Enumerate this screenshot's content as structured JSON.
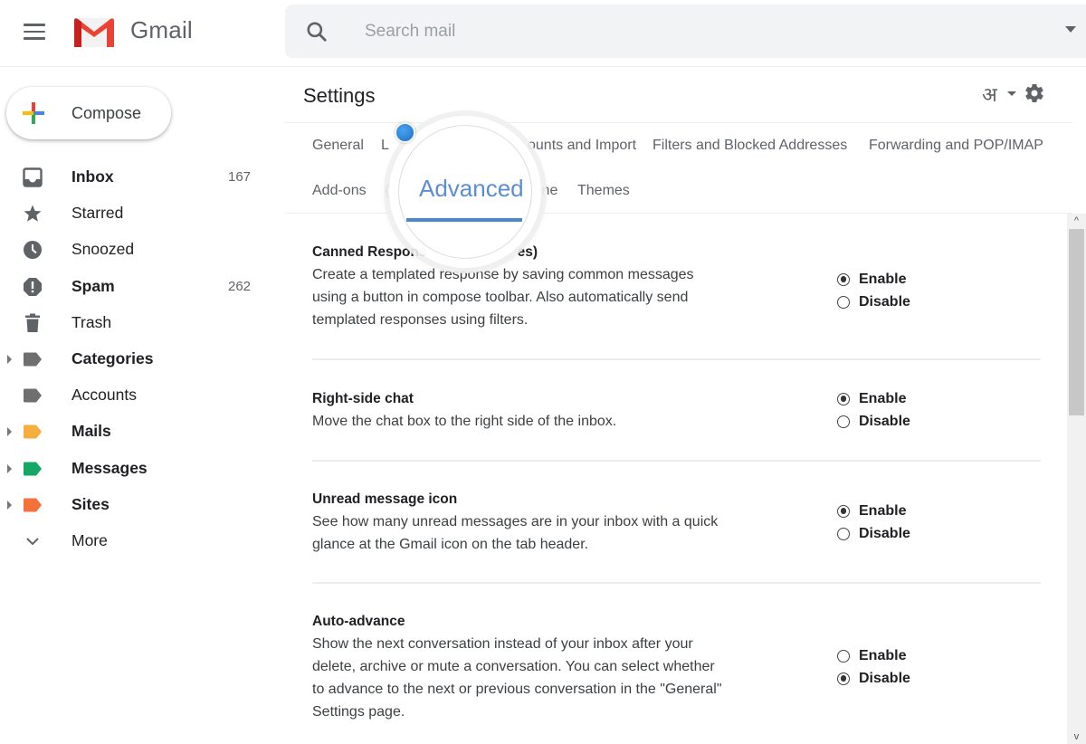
{
  "app": {
    "brand": "Gmail",
    "brand_color": "#EA4335"
  },
  "search": {
    "placeholder": "Search mail",
    "value": ""
  },
  "compose": {
    "label": "Compose"
  },
  "sidebar": {
    "items": [
      {
        "label": "Inbox",
        "count": "167",
        "bold": true,
        "icon": "inbox-icon"
      },
      {
        "label": "Starred",
        "count": "",
        "bold": false,
        "icon": "star-icon"
      },
      {
        "label": "Snoozed",
        "count": "",
        "bold": false,
        "icon": "clock-icon"
      },
      {
        "label": "Spam",
        "count": "262",
        "bold": true,
        "icon": "spam-icon"
      },
      {
        "label": "Trash",
        "count": "",
        "bold": false,
        "icon": "trash-icon"
      },
      {
        "label": "Categories",
        "count": "",
        "bold": true,
        "icon": "label-icon",
        "color": "#6f6f6f",
        "expandable": true
      },
      {
        "label": "Accounts",
        "count": "",
        "bold": false,
        "icon": "label-icon",
        "color": "#6f6f6f"
      },
      {
        "label": "Mails",
        "count": "",
        "bold": true,
        "icon": "label-icon",
        "color": "#F6AE3F",
        "expandable": true
      },
      {
        "label": "Messages",
        "count": "",
        "bold": true,
        "icon": "label-icon",
        "color": "#16A765",
        "expandable": true
      },
      {
        "label": "Sites",
        "count": "",
        "bold": true,
        "icon": "label-icon",
        "color": "#F4713A",
        "expandable": true
      },
      {
        "label": "More",
        "count": "",
        "bold": false,
        "icon": "chevron-down-icon"
      }
    ]
  },
  "settings": {
    "title": "Settings",
    "lang_glyph": "अ",
    "tabs_row1": [
      "General",
      "L",
      "ounts and Import",
      "Filters and Blocked Addresses",
      "Forwarding and POP/IMAP"
    ],
    "tabs_row2": [
      "Add-ons",
      "(",
      "ine",
      "Themes"
    ],
    "active_tab": "Advanced",
    "active_color": "#4A86D3",
    "sections": [
      {
        "name": "Canned Respons",
        "name_tail": "es)",
        "desc": "Create a templated response by saving common messages using a button in compose toolbar. Also automatically send templated responses using filters.",
        "options": [
          "Enable",
          "Disable"
        ],
        "selected": "Enable"
      },
      {
        "name": "Right-side chat",
        "name_tail": "",
        "desc": "Move the chat box to the right side of the inbox.",
        "options": [
          "Enable",
          "Disable"
        ],
        "selected": "Enable"
      },
      {
        "name": "Unread message icon",
        "name_tail": "",
        "desc": "See how many unread messages are in your inbox with a quick glance at the Gmail icon on the tab header.",
        "options": [
          "Enable",
          "Disable"
        ],
        "selected": "Enable"
      },
      {
        "name": "Auto-advance",
        "name_tail": "",
        "desc": "Show the next conversation instead of your inbox after your delete, archive or mute a conversation. You can select whether to advance to the next or previous conversation in the \"General\" Settings page.",
        "options": [
          "Enable",
          "Disable"
        ],
        "selected": "Disable"
      }
    ]
  },
  "scrollbar": {
    "up": "^",
    "down": "v"
  }
}
